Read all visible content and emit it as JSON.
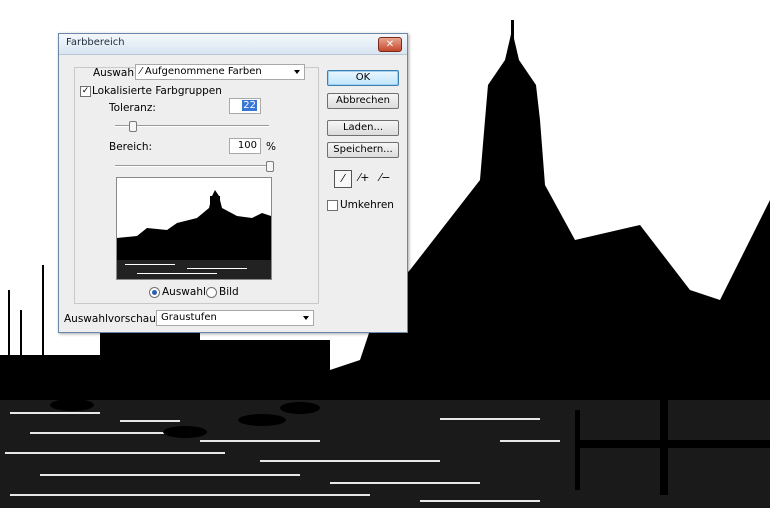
{
  "dialog": {
    "title": "Farbbereich",
    "close_glyph": "✕",
    "selection": {
      "label": "Auswahl:",
      "value": "Aufgenommene Farben",
      "icon": "eyedropper-icon"
    },
    "localized_groups": {
      "label": "Lokalisierte Farbgruppen",
      "checked": true,
      "check_glyph": "✓"
    },
    "tolerance": {
      "label": "Toleranz:",
      "value": "22",
      "slider_fraction": 0.11
    },
    "range": {
      "label": "Bereich:",
      "value": "100",
      "unit": "%",
      "slider_fraction": 1.0
    },
    "preview_radio": {
      "selection_label": "Auswahl",
      "image_label": "Bild",
      "selected": "Auswahl"
    },
    "preview_mode": {
      "label": "Auswahlvorschau:",
      "value": "Graustufen"
    },
    "buttons": {
      "ok": "OK",
      "cancel": "Abbrechen",
      "load": "Laden...",
      "save": "Speichern..."
    },
    "tools": [
      "eyedropper-icon",
      "eyedropper-plus-icon",
      "eyedropper-minus-icon"
    ],
    "tool_glyphs": [
      "⁄",
      "⁄+",
      "⁄−"
    ],
    "invert": {
      "label": "Umkehren",
      "checked": false
    }
  },
  "colors": {
    "accent": "#3875d7",
    "titlebar": "#d9e5f1",
    "close": "#c4482c"
  }
}
